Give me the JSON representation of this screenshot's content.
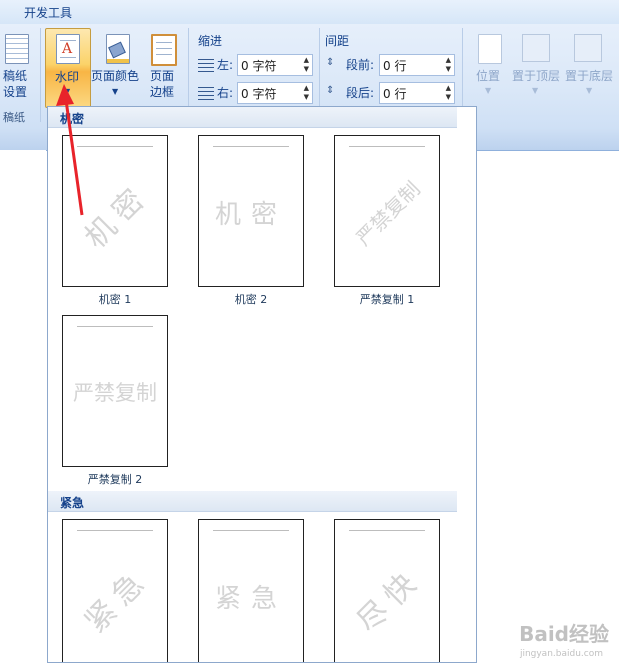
{
  "ribbon": {
    "tab_label": "开发工具",
    "manuscript": {
      "label_line1": "稿纸",
      "label_line2": "设置",
      "group_label": "稿纸"
    },
    "watermark": {
      "label": "水印"
    },
    "page_color": {
      "label": "页面颜色"
    },
    "page_border": {
      "label_line1": "页面",
      "label_line2": "边框"
    },
    "indent": {
      "title": "缩进",
      "left_label": "左:",
      "left_value": "0 字符",
      "right_label": "右:",
      "right_value": "0 字符"
    },
    "spacing": {
      "title": "间距",
      "before_label": "段前:",
      "before_value": "0 行",
      "after_label": "段后:",
      "after_value": "0 行"
    },
    "arrange": {
      "position_label": "位置",
      "bring_front_label": "置于顶层",
      "send_back_label": "置于底层"
    }
  },
  "gallery": {
    "categories": [
      {
        "title": "机密",
        "items": [
          {
            "caption": "机密 1",
            "watermark_text": "机密",
            "diagonal": true
          },
          {
            "caption": "机密 2",
            "watermark_text": "机密",
            "diagonal": false
          },
          {
            "caption": "严禁复制 1",
            "watermark_text": "严禁复制",
            "diagonal": true
          },
          {
            "caption": "严禁复制 2",
            "watermark_text": "严禁复制",
            "diagonal": false
          }
        ]
      },
      {
        "title": "紧急",
        "items": [
          {
            "caption": "",
            "watermark_text": "紧急",
            "diagonal": true
          },
          {
            "caption": "",
            "watermark_text": "紧急",
            "diagonal": false
          },
          {
            "caption": "",
            "watermark_text": "尽快",
            "diagonal": true
          }
        ]
      }
    ]
  },
  "overlay": {
    "logo_text": "Baid经验",
    "logo_sub": "jingyan.baidu.com"
  },
  "colors": {
    "annotation_arrow": "#e8232a",
    "highlight_button": "#f9c55a",
    "ribbon_text": "#15428b"
  }
}
